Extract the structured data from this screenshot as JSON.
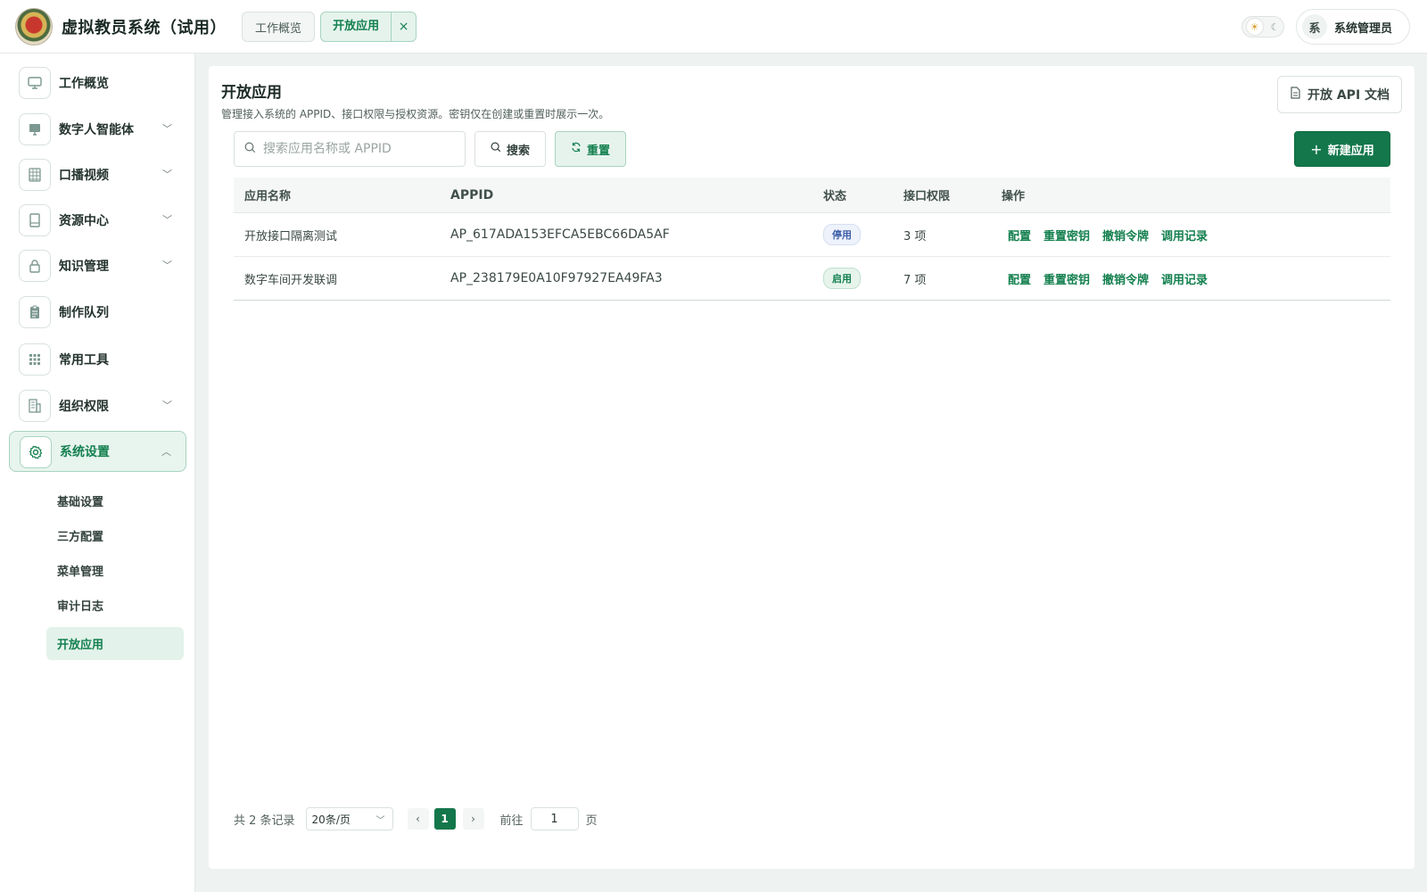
{
  "header": {
    "app_title": "虚拟教员系统（试用）",
    "tabs": [
      {
        "label": "工作概览"
      },
      {
        "label": "开放应用",
        "close": "×"
      }
    ],
    "user": {
      "avatar_text": "系",
      "name": "系统管理员"
    }
  },
  "sidebar": {
    "items": [
      {
        "label": "工作概览",
        "icon": "monitor-icon"
      },
      {
        "label": "数字人智能体",
        "icon": "screen-icon"
      },
      {
        "label": "口播视频",
        "icon": "video-grid-icon"
      },
      {
        "label": "资源中心",
        "icon": "book-icon"
      },
      {
        "label": "知识管理",
        "icon": "lock-icon"
      },
      {
        "label": "制作队列",
        "icon": "clipboard-icon"
      },
      {
        "label": "常用工具",
        "icon": "apps-grid-icon"
      },
      {
        "label": "组织权限",
        "icon": "building-icon"
      },
      {
        "label": "系统设置",
        "icon": "gear-icon"
      }
    ],
    "sub_items": [
      {
        "label": "基础设置"
      },
      {
        "label": "三方配置"
      },
      {
        "label": "菜单管理"
      },
      {
        "label": "审计日志"
      },
      {
        "label": "开放应用"
      }
    ]
  },
  "main": {
    "title": "开放应用",
    "description": "管理接入系统的 APPID、接口权限与授权资源。密钥仅在创建或重置时展示一次。",
    "api_doc_button": "开放 API 文档",
    "search_placeholder": "搜索应用名称或 APPID",
    "search_button": "搜索",
    "reset_button": "重置",
    "new_button": "新建应用",
    "table": {
      "headers": [
        "应用名称",
        "APPID",
        "状态",
        "接口权限",
        "操作"
      ],
      "rows": [
        {
          "name": "开放接口隔离测试",
          "appid": "AP_617ADA153EFCA5EBC66DA5AF",
          "status": "停用",
          "perm": "3 项"
        },
        {
          "name": "数字车间开发联调",
          "appid": "AP_238179E0A10F97927EA49FA3",
          "status": "启用",
          "perm": "7 项"
        }
      ],
      "actions": [
        "配置",
        "重置密钥",
        "撤销令牌",
        "调用记录"
      ]
    },
    "pager": {
      "total": "共 2 条记录",
      "page_size": "20条/页",
      "current_page": "1",
      "goto_label": "前往",
      "goto_value": "1",
      "page_word": "页"
    }
  },
  "colors": {
    "accent": "#13774b",
    "accent_light": "#e6f3ed"
  }
}
